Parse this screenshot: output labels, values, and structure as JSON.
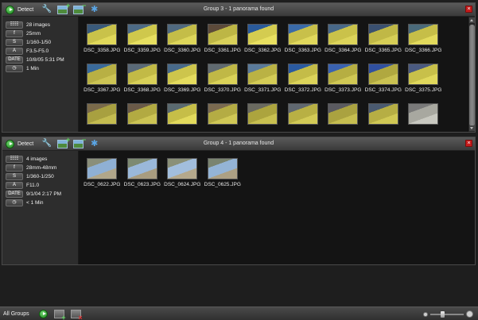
{
  "toolbar": {
    "detect_label": "Detect"
  },
  "groups": [
    {
      "title": "Group 3 - 1 panorama found",
      "info": [
        {
          "badge": "☷☷",
          "value": "28 images"
        },
        {
          "badge": "f",
          "value": "25mm"
        },
        {
          "badge": "S",
          "value": "1/160-1/50"
        },
        {
          "badge": "A",
          "value": "F3.5-F5.0"
        },
        {
          "badge": "DATE",
          "value": "10/8/05 5:31 PM"
        },
        {
          "badge": "◷",
          "value": "1 Min"
        }
      ],
      "images": [
        {
          "label": "DSC_3358.JPG",
          "colors": [
            "#c9c24a",
            "#3a5a7a",
            "#e0d85a"
          ]
        },
        {
          "label": "DSC_3359.JPG",
          "colors": [
            "#cfc84c",
            "#4d6b86",
            "#e6df60"
          ]
        },
        {
          "label": "DSC_3360.JPG",
          "colors": [
            "#c4bd48",
            "#506a80",
            "#ddd65a"
          ]
        },
        {
          "label": "DSC_3361.JPG",
          "colors": [
            "#bdb645",
            "#5c4a3a",
            "#d8d05a"
          ]
        },
        {
          "label": "DSC_3362.JPG",
          "colors": [
            "#d4cc50",
            "#2a5a9a",
            "#e8e060"
          ]
        },
        {
          "label": "DSC_3363.JPG",
          "colors": [
            "#c8c04a",
            "#3a6aa8",
            "#e0d85c"
          ]
        },
        {
          "label": "DSC_3364.JPG",
          "colors": [
            "#cac24a",
            "#486888",
            "#dcd45a"
          ]
        },
        {
          "label": "DSC_3365.JPG",
          "colors": [
            "#c0b846",
            "#3a5070",
            "#d6ce56"
          ]
        },
        {
          "label": "DSC_3366.JPG",
          "colors": [
            "#c6be48",
            "#4a6a7a",
            "#e2da5c"
          ]
        },
        {
          "label": "DSC_3367.JPG",
          "colors": [
            "#b8b044",
            "#3a6a9a",
            "#ccc454"
          ]
        },
        {
          "label": "DSC_3368.JPG",
          "colors": [
            "#c2ba46",
            "#5a6a78",
            "#d8d058"
          ]
        },
        {
          "label": "DSC_3369.JPG",
          "colors": [
            "#cdc54c",
            "#486a8a",
            "#e4dc5e"
          ]
        },
        {
          "label": "DSC_3370.JPG",
          "colors": [
            "#c0b846",
            "#606a70",
            "#dad258"
          ]
        },
        {
          "label": "DSC_3371.JPG",
          "colors": [
            "#bab244",
            "#5a7a9a",
            "#d4cc56"
          ]
        },
        {
          "label": "DSC_3372.JPG",
          "colors": [
            "#c4bc48",
            "#2a5aa0",
            "#dcd45a"
          ]
        },
        {
          "label": "DSC_3373.JPG",
          "colors": [
            "#b6ae42",
            "#3a62b0",
            "#d0c854"
          ]
        },
        {
          "label": "DSC_3374.JPG",
          "colors": [
            "#b0a840",
            "#3050a0",
            "#cac252"
          ]
        },
        {
          "label": "DSC_3375.JPG",
          "colors": [
            "#c8c04a",
            "#4a5a80",
            "#e0d85c"
          ]
        },
        {
          "label": "",
          "colors": [
            "#a8a040",
            "#7a6a4a",
            "#c4bc50"
          ]
        },
        {
          "label": "",
          "colors": [
            "#b2aa42",
            "#6a5a48",
            "#ccc454"
          ]
        },
        {
          "label": "",
          "colors": [
            "#c6be48",
            "#5a6a70",
            "#e2da5c"
          ]
        },
        {
          "label": "",
          "colors": [
            "#b4ac44",
            "#7a6a50",
            "#d0c856"
          ]
        },
        {
          "label": "",
          "colors": [
            "#aca43e",
            "#6a6a60",
            "#c8c050"
          ]
        },
        {
          "label": "",
          "colors": [
            "#b8b044",
            "#606870",
            "#d2ca56"
          ]
        },
        {
          "label": "",
          "colors": [
            "#aaa240",
            "#5a5a60",
            "#c6be50"
          ]
        },
        {
          "label": "",
          "colors": [
            "#b6ae44",
            "#4a5a70",
            "#d0c854"
          ]
        },
        {
          "label": "",
          "colors": [
            "#a8a8a0",
            "#7a7a7a",
            "#c8c8c0"
          ]
        }
      ]
    },
    {
      "title": "Group 4 - 1 panorama found",
      "info": [
        {
          "badge": "☷☷",
          "value": "4 images"
        },
        {
          "badge": "f",
          "value": "28mm-48mm"
        },
        {
          "badge": "S",
          "value": "1/360-1/250"
        },
        {
          "badge": "A",
          "value": "F11.0"
        },
        {
          "badge": "DATE",
          "value": "9/1/04 2:17 PM"
        },
        {
          "badge": "◷",
          "value": "< 1 Min"
        }
      ],
      "images": [
        {
          "label": "DSC_0622.JPG",
          "colors": [
            "#8fb0d4",
            "#8a8f7a",
            "#b0a68a"
          ]
        },
        {
          "label": "DSC_0623.JPG",
          "colors": [
            "#9ab8da",
            "#7d8a72",
            "#a89c80"
          ]
        },
        {
          "label": "DSC_0624.JPG",
          "colors": [
            "#a2bedd",
            "#8a9078",
            "#b4a88c"
          ]
        },
        {
          "label": "DSC_0625.JPG",
          "colors": [
            "#94b4d6",
            "#7a8470",
            "#aca084"
          ]
        }
      ]
    }
  ],
  "bottom": {
    "all_groups_label": "All Groups",
    "zoom_level": 0.35
  }
}
